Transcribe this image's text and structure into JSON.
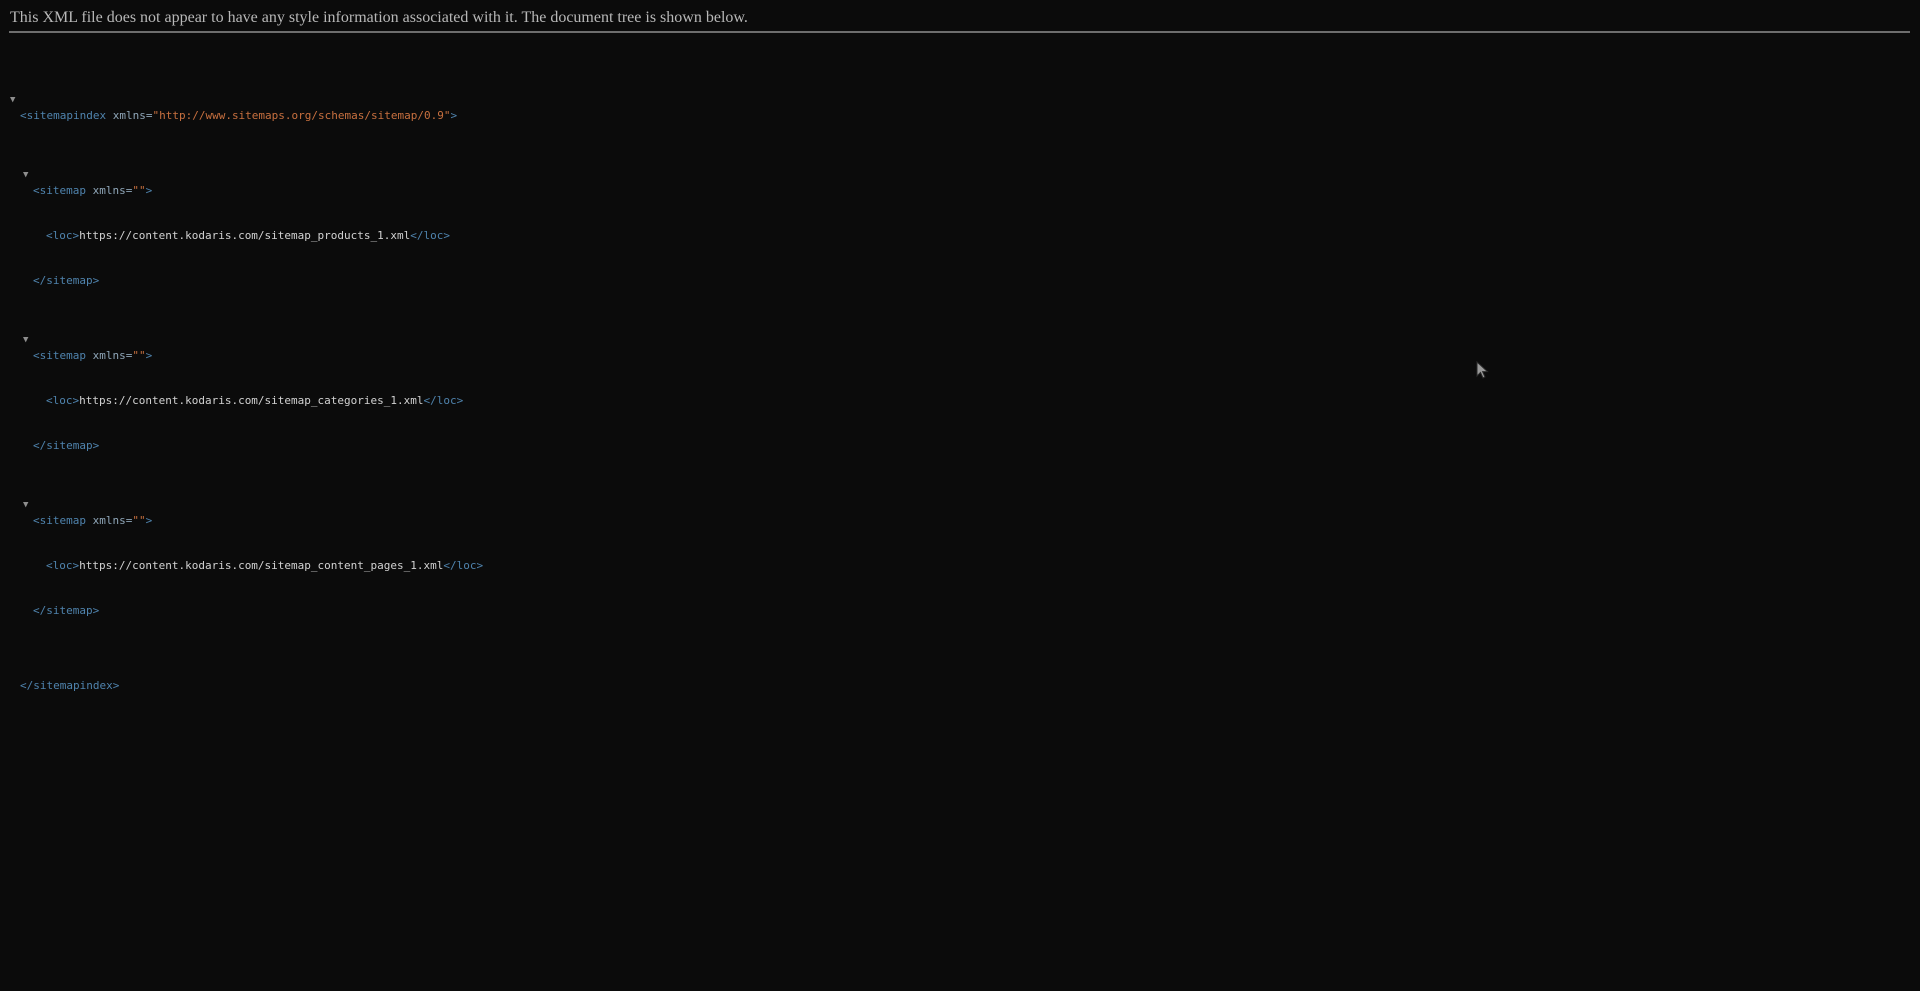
{
  "header": {
    "notice": "This XML file does not appear to have any style information associated with it. The document tree is shown below."
  },
  "toggle_glyph": "▼",
  "root": {
    "open_tag": "<sitemapindex",
    "attr_name": "xmlns=",
    "attr_value": "\"http://www.sitemaps.org/schemas/sitemap/0.9\"",
    "open_close": ">",
    "close_tag": "</sitemapindex>"
  },
  "sitemaps": [
    {
      "open_tag": "<sitemap",
      "attr_name": "xmlns=",
      "attr_value": "\"\"",
      "open_close": ">",
      "loc_open": "<loc>",
      "loc": "https://content.kodaris.com/sitemap_products_1.xml",
      "loc_close": "</loc>",
      "close_tag": "</sitemap>"
    },
    {
      "open_tag": "<sitemap",
      "attr_name": "xmlns=",
      "attr_value": "\"\"",
      "open_close": ">",
      "loc_open": "<loc>",
      "loc": "https://content.kodaris.com/sitemap_categories_1.xml",
      "loc_close": "</loc>",
      "close_tag": "</sitemap>"
    },
    {
      "open_tag": "<sitemap",
      "attr_name": "xmlns=",
      "attr_value": "\"\"",
      "open_close": ">",
      "loc_open": "<loc>",
      "loc": "https://content.kodaris.com/sitemap_content_pages_1.xml",
      "loc_close": "</loc>",
      "close_tag": "</sitemap>"
    }
  ]
}
